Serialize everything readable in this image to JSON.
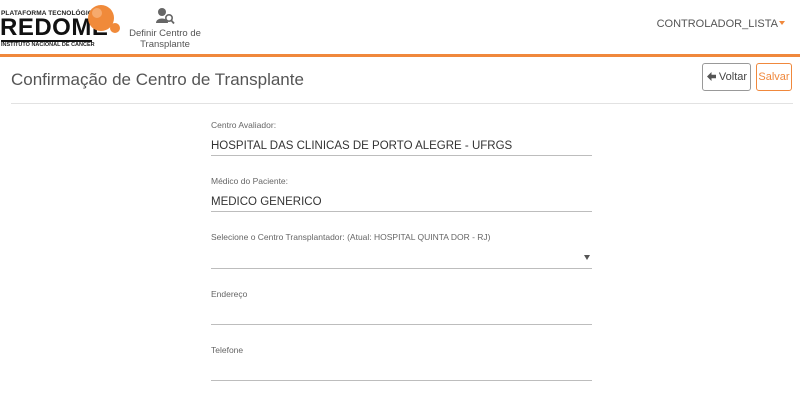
{
  "navbar": {
    "logo": {
      "top_text": "PLATAFORMA TECNOLÓGICA",
      "brand": "REDOME",
      "bottom_text": "INSTITUTO NACIONAL DE CÂNCER"
    },
    "nav_item": {
      "label_line1": "Definir Centro de",
      "label_line2": "Transplante",
      "icon": "user-search-icon"
    },
    "user_menu": {
      "label": "CONTROLADOR_LISTA",
      "caret_icon": "caret-down-icon"
    },
    "accent_color": "#f0883c"
  },
  "page": {
    "title": "Confirmação de Centro de Transplante",
    "buttons": {
      "back_label": "Voltar",
      "back_icon": "arrow-left-icon",
      "save_label": "Salvar"
    }
  },
  "form": {
    "centro_avaliador": {
      "label": "Centro Avaliador:",
      "value": "HOSPITAL DAS CLÍNICAS DE PORTO ALEGRE - UFRGS"
    },
    "medico": {
      "label": "Médico do Paciente:",
      "value": "MEDICO GENERICO"
    },
    "centro_transplantador": {
      "label": "Selecione o Centro Transplantador: (Atual: HOSPITAL QUINTA DOR - RJ)",
      "value": ""
    },
    "endereco": {
      "label": "Endereço",
      "value": ""
    },
    "telefone": {
      "label": "Telefone",
      "value": ""
    }
  }
}
